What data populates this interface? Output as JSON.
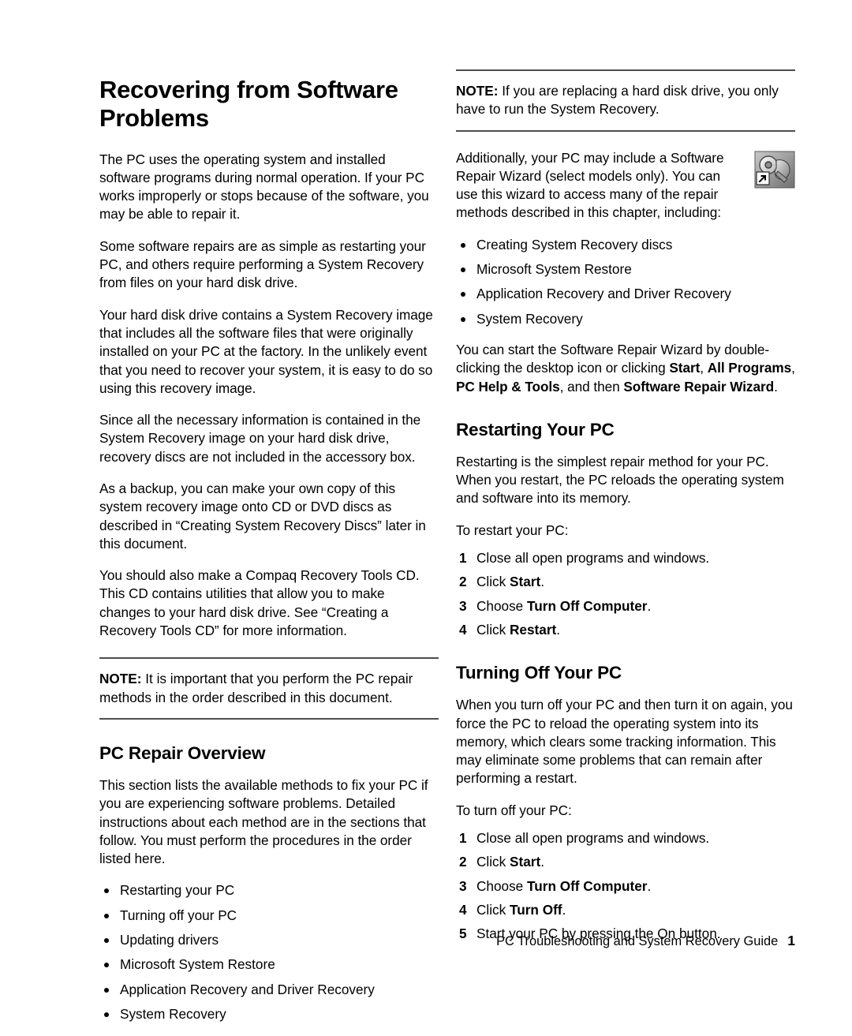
{
  "document": {
    "title": "Recovering from Software Problems",
    "footer": {
      "guide_title": "PC Troubleshooting and System Recovery Guide",
      "page_number": "1"
    }
  },
  "left_column": {
    "paragraphs": [
      "The PC uses the operating system and installed software programs during normal operation. If your PC works improperly or stops because of the software, you may be able to repair it.",
      "Some software repairs are as simple as restarting your PC, and others require performing a System Recovery from files on your hard disk drive.",
      "Your hard disk drive contains a System Recovery image that includes all the software files that were originally installed on your PC at the factory. In the unlikely event that you need to recover your system, it is easy to do so using this recovery image.",
      "Since all the necessary information is contained in the System Recovery image on your hard disk drive, recovery discs are not included in the accessory box.",
      "As a backup, you can make your own copy of this system recovery image onto CD or DVD discs as described in “Creating System Recovery Discs” later in this document.",
      "You should also make a Compaq Recovery Tools CD. This CD contains utilities that allow you to make changes to your hard disk drive. See “Creating a Recovery Tools CD” for more information."
    ],
    "note": {
      "label": "NOTE:",
      "text": " It is important that you perform the PC repair methods in the order described in this document."
    },
    "section": {
      "heading": "PC Repair Overview",
      "intro": "This section lists the available methods to fix your PC if you are experiencing software problems. Detailed instructions about each method are in the sections that follow. You must perform the procedures in the order listed here.",
      "bullets": [
        "Restarting your PC",
        "Turning off your PC",
        "Updating drivers",
        "Microsoft System Restore",
        "Application Recovery and Driver Recovery",
        "System Recovery"
      ]
    }
  },
  "right_column": {
    "note": {
      "label": "NOTE:",
      "text": " If you are replacing a hard disk drive, you only have to run the System Recovery."
    },
    "wizard": {
      "icon_name": "software-repair-wizard-shortcut-icon",
      "paragraph": "Additionally, your PC may include a Software Repair Wizard (select models only). You can use this wizard to access many of the repair methods described in this chapter, including:",
      "bullets": [
        "Creating System Recovery discs",
        "Microsoft System Restore",
        "Application Recovery and Driver Recovery",
        "System Recovery"
      ],
      "launch_text_1": "You can start the Software Repair Wizard by double-clicking the desktop icon or clicking ",
      "launch_bold_1": "Start",
      "launch_text_2": ", ",
      "launch_bold_2": "All Programs",
      "launch_text_3": ", ",
      "launch_bold_3": "PC Help & Tools",
      "launch_text_4": ", and then ",
      "launch_bold_4": "Software Repair Wizard",
      "launch_text_5": "."
    },
    "restarting": {
      "heading": "Restarting Your PC",
      "paragraph": "Restarting is the simplest repair method for your PC. When you restart, the PC reloads the operating system and software into its memory.",
      "lead_in": "To restart your PC:",
      "steps": [
        {
          "prefix": "Close all open programs and windows.",
          "bold": "",
          "suffix": ""
        },
        {
          "prefix": "Click ",
          "bold": "Start",
          "suffix": "."
        },
        {
          "prefix": "Choose ",
          "bold": "Turn Off Computer",
          "suffix": "."
        },
        {
          "prefix": "Click ",
          "bold": "Restart",
          "suffix": "."
        }
      ]
    },
    "turning_off": {
      "heading": "Turning Off Your PC",
      "paragraph": "When you turn off your PC and then turn it on again, you force the PC to reload the operating system into its memory, which clears some tracking information. This may eliminate some problems that can remain after performing a restart.",
      "lead_in": "To turn off your PC:",
      "steps": [
        {
          "prefix": "Close all open programs and windows.",
          "bold": "",
          "suffix": ""
        },
        {
          "prefix": "Click ",
          "bold": "Start",
          "suffix": "."
        },
        {
          "prefix": "Choose ",
          "bold": "Turn Off Computer",
          "suffix": "."
        },
        {
          "prefix": "Click ",
          "bold": "Turn Off",
          "suffix": "."
        },
        {
          "prefix": "Start your PC by pressing the On button.",
          "bold": "",
          "suffix": ""
        }
      ]
    }
  },
  "colors": {
    "text": "#000000",
    "rule": "#4d4d4d",
    "page_background": "#ffffff"
  }
}
